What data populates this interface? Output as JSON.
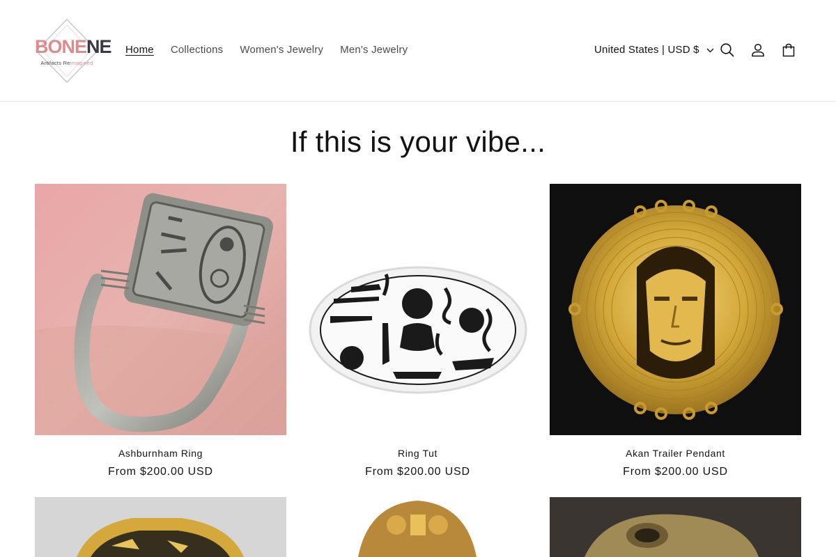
{
  "brand": {
    "logo_main_light": "BONE",
    "logo_main_dark": "NE",
    "logo_sub_start": "Artifacts Re",
    "logo_sub_end": "imagined"
  },
  "nav": {
    "items": [
      {
        "label": "Home",
        "active": true
      },
      {
        "label": "Collections"
      },
      {
        "label": "Women's Jewelry"
      },
      {
        "label": "Men's Jewelry"
      }
    ]
  },
  "header": {
    "locale_label": "United States | USD $",
    "icons": [
      "search-icon",
      "account-icon",
      "cart-icon"
    ]
  },
  "section": {
    "heading": "If this is your vibe..."
  },
  "products": [
    {
      "title": "Ashburnham Ring",
      "price": "From $200.00 USD"
    },
    {
      "title": "Ring Tut",
      "price": "From $200.00 USD"
    },
    {
      "title": "Akan Trailer Pendant",
      "price": "From $200.00 USD"
    }
  ],
  "colors": {
    "accent_pink": "#d98d8d",
    "text": "#121212",
    "gold": "#d4a83a"
  }
}
